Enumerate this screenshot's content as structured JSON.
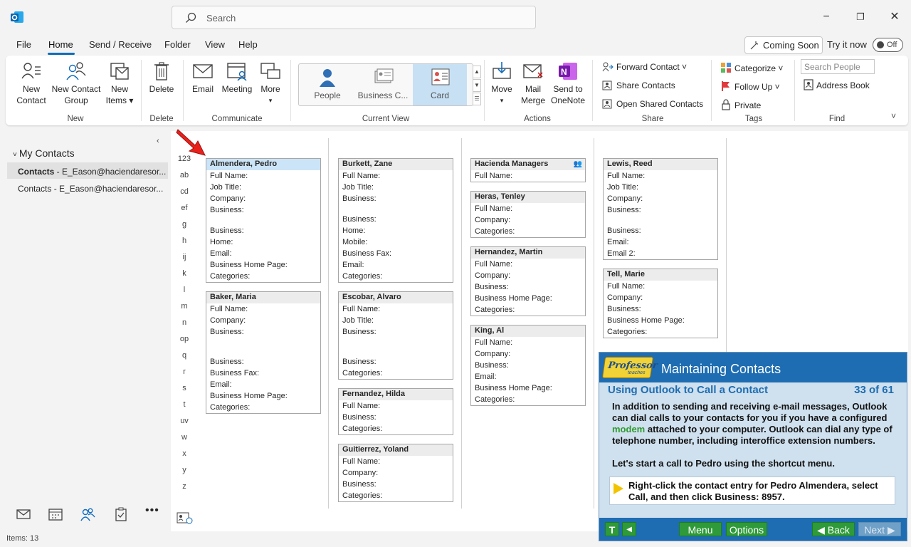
{
  "titlebar": {
    "search_placeholder": "Search",
    "minimize": "−",
    "restore": "❐",
    "close": "✕"
  },
  "menu": {
    "items": [
      "File",
      "Home",
      "Send / Receive",
      "Folder",
      "View",
      "Help"
    ],
    "active": "Home",
    "coming_soon": "Coming Soon",
    "try_it": "Try it now",
    "toggle": "Off"
  },
  "ribbon": {
    "new_group": {
      "label": "New",
      "new_contact": [
        "New",
        "Contact"
      ],
      "new_contact_group": [
        "New Contact",
        "Group"
      ],
      "new_items": [
        "New",
        "Items ▾"
      ]
    },
    "delete_group": {
      "label": "Delete",
      "delete": "Delete"
    },
    "communicate_group": {
      "label": "Communicate",
      "email": "Email",
      "meeting": "Meeting",
      "more": "More"
    },
    "current_view": {
      "label": "Current View",
      "people": "People",
      "business_card": "Business C...",
      "card": "Card",
      "selected": "Card"
    },
    "actions": {
      "label": "Actions",
      "move": "Move",
      "mail_merge": [
        "Mail",
        "Merge"
      ],
      "send_onenote": [
        "Send to",
        "OneNote"
      ]
    },
    "share": {
      "label": "Share",
      "forward_contact": "Forward Contact ˅",
      "share_contacts": "Share Contacts",
      "open_shared": "Open Shared Contacts"
    },
    "tags": {
      "label": "Tags",
      "categorize": "Categorize ˅",
      "follow_up": "Follow Up ˅",
      "private": "Private"
    },
    "find": {
      "label": "Find",
      "search_people_placeholder": "Search People",
      "address_book": "Address Book"
    }
  },
  "nav": {
    "header": "My Contacts",
    "items": [
      {
        "bold": "Contacts",
        "rest": " - E_Eason@haciendaresor..."
      },
      {
        "bold": "",
        "rest": "Contacts - E_Eason@haciendaresor..."
      }
    ]
  },
  "alphabet": [
    "123",
    "ab",
    "cd",
    "ef",
    "g",
    "h",
    "ij",
    "k",
    "l",
    "m",
    "n",
    "op",
    "q",
    "r",
    "s",
    "t",
    "uv",
    "w",
    "x",
    "y",
    "z"
  ],
  "contacts": {
    "col1": [
      {
        "name": "Almendera, Pedro",
        "fields": [
          "Full Name:",
          "Job Title:",
          "Company:",
          "Business:",
          "",
          "Business:",
          "Home:",
          "Email:",
          "Business Home Page:",
          "Categories:"
        ]
      },
      {
        "name": "Baker, Maria",
        "fields": [
          "Full Name:",
          "Company:",
          "Business:",
          "",
          "",
          "Business:",
          "Business Fax:",
          "Email:",
          "Business Home Page:",
          "Categories:"
        ]
      }
    ],
    "col2": [
      {
        "name": "Burkett, Zane",
        "fields": [
          "Full Name:",
          "Job Title:",
          "Business:",
          "",
          "Business:",
          "Home:",
          "Mobile:",
          "Business Fax:",
          "Email:",
          "Categories:"
        ]
      },
      {
        "name": "Escobar, Alvaro",
        "fields": [
          "Full Name:",
          "Job Title:",
          "Business:",
          "",
          "",
          "Business:",
          "Categories:"
        ]
      },
      {
        "name": "Fernandez, Hilda",
        "fields": [
          "Full Name:",
          "Business:",
          "Categories:"
        ]
      },
      {
        "name": "Guitierrez, Yoland",
        "fields": [
          "Full Name:",
          "Company:",
          "Business:",
          "Categories:"
        ]
      }
    ],
    "col3": [
      {
        "name": "Hacienda Managers",
        "fields": [
          "Full Name:"
        ]
      },
      {
        "name": "Heras, Tenley",
        "fields": [
          "Full Name:",
          "Company:",
          "Categories:"
        ]
      },
      {
        "name": "Hernandez, Martin",
        "fields": [
          "Full Name:",
          "Company:",
          "Business:",
          "Business Home Page:",
          "Categories:"
        ]
      },
      {
        "name": "King, Al",
        "fields": [
          "Full Name:",
          "Company:",
          "Business:",
          "Email:",
          "Business Home Page:",
          "Categories:"
        ]
      }
    ],
    "col4": [
      {
        "name": "Lewis, Reed",
        "fields": [
          "Full Name:",
          "Job Title:",
          "Company:",
          "Business:",
          "",
          "Business:",
          "Email:",
          "Email 2:"
        ]
      },
      {
        "name": "Tell, Marie",
        "fields": [
          "Full Name:",
          "Company:",
          "Business:",
          "Business Home Page:",
          "Categories:"
        ]
      }
    ]
  },
  "status": {
    "items": "Items: 13"
  },
  "professor": {
    "logo": "Professor",
    "logo_small": "teaches",
    "title": "Maintaining Contacts",
    "subtitle": "Using Outlook to Call a Contact",
    "count": "33 of 61",
    "p1_a": "In addition to sending and receiving e-mail messages, Outlook can dial calls to your contacts for you if you have a configured ",
    "p1_link": "modem",
    "p1_b": " attached to your computer. Outlook can dial any type of telephone number, including interoffice extension numbers.",
    "p2": "Let's start a call to Pedro using the shortcut menu.",
    "instruction": "Right-click the contact entry for Pedro Almendera, select Call, and then click Business: 8957.",
    "btn_t": "T",
    "btn_prev_small": "◀",
    "btn_menu": "Menu",
    "btn_options": "Options",
    "btn_back": "◀ Back",
    "btn_next": "Next ▶"
  },
  "colors": {
    "accent": "#0f6cbd",
    "prof_blue": "#1e6db2",
    "prof_green": "#2e9a3a",
    "selected_card": "#cce4f7"
  }
}
